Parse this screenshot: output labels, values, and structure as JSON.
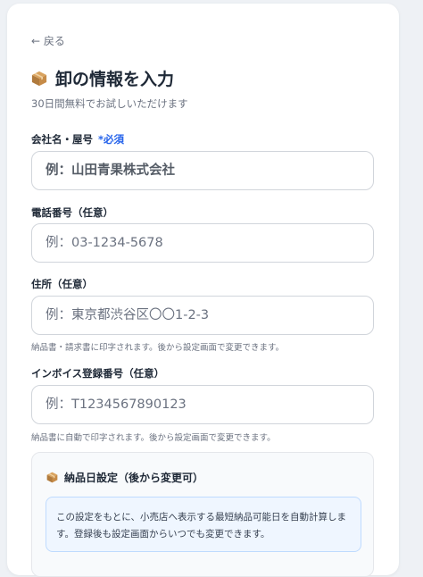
{
  "nav": {
    "back_label": "← 戻る"
  },
  "header": {
    "title": "卸の情報を入力",
    "subtitle": "30日間無料でお試しいただけます",
    "icon": "package-box-icon"
  },
  "form": {
    "company": {
      "label": "会社名・屋号",
      "required_mark": "*必須",
      "placeholder": "例：山田青果株式会社"
    },
    "phone": {
      "label": "電話番号（任意）",
      "placeholder": "例：03-1234-5678"
    },
    "address": {
      "label": "住所（任意）",
      "placeholder": "例：東京都渋谷区〇〇1-2-3",
      "hint": "納品書・請求書に印字されます。後から設定画面で変更できます。"
    },
    "invoice": {
      "label": "インボイス登録番号（任意）",
      "placeholder": "例：T1234567890123",
      "hint": "納品書に自動で印字されます。後から設定画面で変更できます。"
    }
  },
  "delivery": {
    "title": "納品日設定（後から変更可）",
    "info": "この設定をもとに、小売店へ表示する最短納品可能日を自動計算します。登録後も設定画面からいつでも変更できます。"
  },
  "colors": {
    "accent": "#2563eb",
    "info_bg": "#eff6ff",
    "info_border": "#bfdbfe"
  }
}
